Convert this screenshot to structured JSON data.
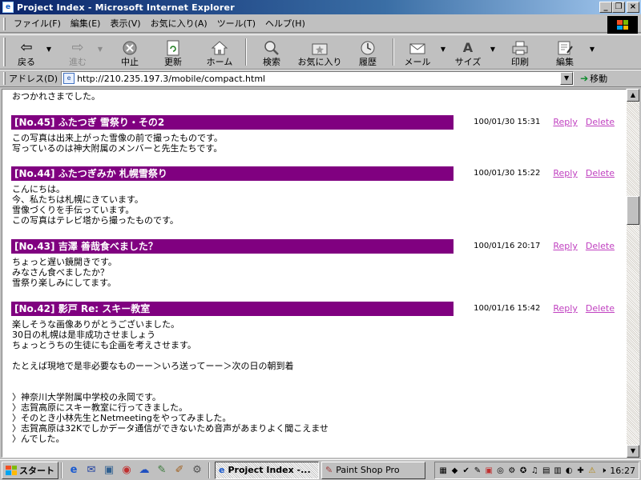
{
  "window": {
    "title": "Project Index - Microsoft Internet Explorer",
    "controls": [
      "_",
      "❐",
      "×"
    ]
  },
  "menu": [
    "ファイル(F)",
    "編集(E)",
    "表示(V)",
    "お気に入り(A)",
    "ツール(T)",
    "ヘルプ(H)"
  ],
  "toolbar": {
    "back": "戻る",
    "forward": "進む",
    "stop": "中止",
    "refresh": "更新",
    "home": "ホーム",
    "search": "検索",
    "favorites": "お気に入り",
    "history": "履歴",
    "mail": "メール",
    "size": "サイズ",
    "print": "印刷",
    "edit": "編集"
  },
  "address": {
    "label": "アドレス(D)",
    "url": "http://210.235.197.3/mobile/compact.html",
    "go": "移動"
  },
  "content": {
    "top_text": "おつかれさまでした。",
    "posts": [
      {
        "header": "[No.45] ふたつぎ 雪祭り・その2",
        "date": "100/01/30 15:31",
        "reply": "Reply",
        "delete": "Delete",
        "body": "この写真は出来上がった雪像の前で撮ったものです。\n写っているのは神大附属のメンバーと先生たちです。"
      },
      {
        "header": "[No.44] ふたつぎみか 札幌雪祭り",
        "date": "100/01/30 15:22",
        "reply": "Reply",
        "delete": "Delete",
        "body": "こんにちは。\n今、私たちは札幌にきています。\n雪像づくりを手伝っています。\nこの写真はテレビ塔から撮ったものです。"
      },
      {
        "header": "[No.43] 吉澤 善哉食べました？",
        "date": "100/01/16 20:17",
        "reply": "Reply",
        "delete": "Delete",
        "body": "ちょっと遅い鏡開きです。\nみなさん食べましたか？\n雪祭り楽しみにしてます。"
      },
      {
        "header": "[No.42] 影戸 Re: スキー教室",
        "date": "100/01/16 15:42",
        "reply": "Reply",
        "delete": "Delete",
        "body": "楽しそうな画像ありがとうございました。\n30日の札幌は是非成功させましょう\nちょっとうちの生徒にも企画を考えさせます。\n\nたとえば現地で是非必要なものーー＞いろ送ってーー＞次の日の朝到着\n\n\n〉神奈川大学附属中学校の永岡です。\n〉志賀高原にスキー教室に行ってきました。\n〉そのとき小林先生とNetmeetingをやってみました。\n〉志賀高原は32Kでしかデータ通信ができないため音声があまりよく聞こえませ\n〉んでした。"
      }
    ]
  },
  "taskbar": {
    "start": "スタート",
    "tasks": [
      "Project Index -...",
      "Paint Shop Pro"
    ],
    "clock": "16:27"
  }
}
